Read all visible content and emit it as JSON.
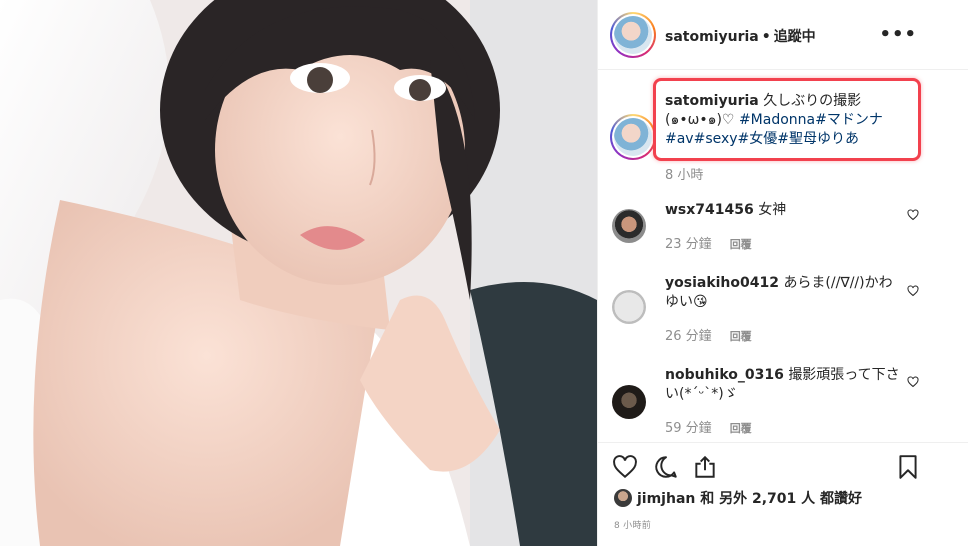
{
  "post": {
    "username": "satomiyuria",
    "follow_status": "追蹤中",
    "more_label": "•••"
  },
  "caption": {
    "username": "satomiyuria",
    "text": "久しぶりの撮影(๑•ω•๑)♡",
    "hashtags": "#Madonna#マドンナ#av#sexy#女優#聖母ゆりあ",
    "time": "8 小時"
  },
  "comments": [
    {
      "username": "wsx741456",
      "text": "女神",
      "time": "23 分鐘",
      "reply_label": "回覆"
    },
    {
      "username": "yosiakiho0412",
      "text": "あらま(//∇//)かわゆい😘",
      "time": "26 分鐘",
      "reply_label": "回覆"
    },
    {
      "username": "nobuhiko_0316",
      "text": "撮影頑張って下さい(*ˊᵕˋ*)ゞ",
      "time": "59 分鐘",
      "reply_label": "回覆"
    }
  ],
  "likes": {
    "user": "jimjhan",
    "text": "和 另外 2,701 人 都讚好"
  },
  "post_time": "8 小時前",
  "icons": {
    "like": "heart-icon",
    "comment": "comment-icon",
    "share": "share-icon",
    "save": "bookmark-icon",
    "more": "more-options-icon"
  },
  "colors": {
    "highlight_border": "#f2414e",
    "hashtag": "#003569",
    "secondary_text": "#8e8e8e"
  }
}
